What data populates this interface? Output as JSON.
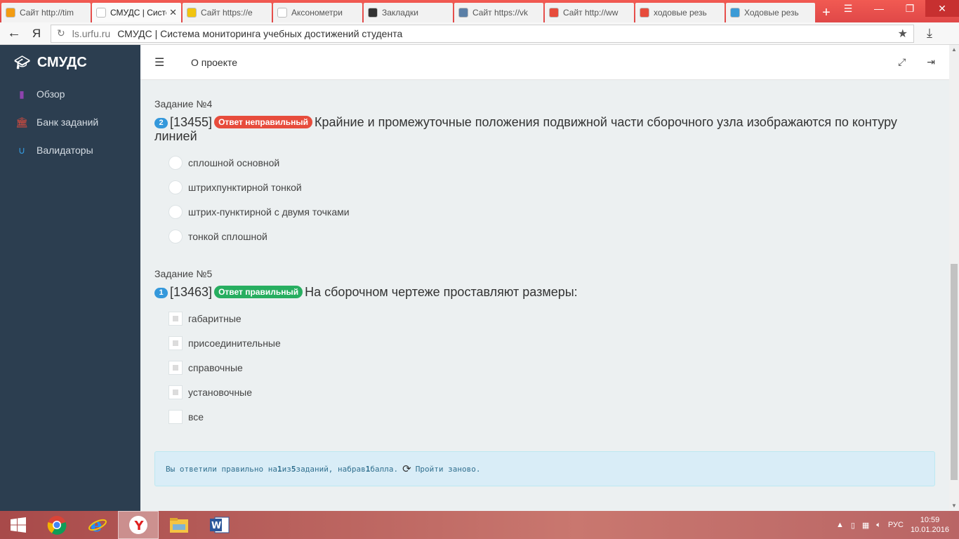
{
  "browser": {
    "tabs": [
      {
        "title": "Сайт http://tim",
        "icon_color": "#f39c12",
        "active": false
      },
      {
        "title": "СМУДС | Систе",
        "icon_color": "#ffffff",
        "active": true
      },
      {
        "title": "Сайт https://e",
        "icon_color": "#f1c40f",
        "active": false
      },
      {
        "title": "Аксонометри",
        "icon_color": "#ffffff",
        "active": false
      },
      {
        "title": "Закладки",
        "icon_color": "#333333",
        "active": false
      },
      {
        "title": "Сайт https://vk",
        "icon_color": "#5b7fa6",
        "active": false
      },
      {
        "title": "Сайт http://ww",
        "icon_color": "#e74c3c",
        "active": false
      },
      {
        "title": "ходовые резь",
        "icon_color": "#e74c3c",
        "active": false
      },
      {
        "title": "Ходовые резь",
        "icon_color": "#3b9bd6",
        "active": false
      }
    ],
    "new_tab": "+",
    "url_domain": "ls.urfu.ru",
    "url_title": "СМУДС | Система мониторинга учебных достижений студента",
    "yandex_logo": "Я"
  },
  "sidebar": {
    "brand": "СМУДС",
    "items": [
      {
        "label": "Обзор",
        "icon": "bar-chart-icon",
        "color": "#8e44ad"
      },
      {
        "label": "Банк заданий",
        "icon": "bank-icon",
        "color": "#e74c3c"
      },
      {
        "label": "Валидаторы",
        "icon": "magnet-icon",
        "color": "#3498db"
      }
    ]
  },
  "topbar": {
    "about": "О проекте"
  },
  "tasks": [
    {
      "title": "Задание №4",
      "number": "2",
      "id": "[13455]",
      "badge": "Ответ неправильный",
      "badge_type": "wrong",
      "question": "Крайние и промежуточные положения подвижной части сборочного узла изображаются по контуру линией",
      "input_type": "radio",
      "options": [
        {
          "label": "сплошной основной",
          "checked": false
        },
        {
          "label": "штрихпунктирной тонкой",
          "checked": false
        },
        {
          "label": "штрих-пунктирной с двумя точками",
          "checked": false
        },
        {
          "label": "тонкой сплошной",
          "checked": false
        }
      ]
    },
    {
      "title": "Задание №5",
      "number": "1",
      "id": "[13463]",
      "badge": "Ответ правильный",
      "badge_type": "right",
      "question": "На сборочном чертеже проставляют размеры:",
      "input_type": "checkbox",
      "options": [
        {
          "label": "габаритные",
          "checked": true
        },
        {
          "label": "присоединительные",
          "checked": true
        },
        {
          "label": "справочные",
          "checked": true
        },
        {
          "label": "установочные",
          "checked": true
        },
        {
          "label": "все",
          "checked": false
        }
      ]
    }
  ],
  "result": {
    "prefix": "Вы ответили правильно на",
    "correct": "1",
    "middle": "из",
    "total": "5",
    "middle2": "заданий, набрав",
    "score": "1",
    "suffix": "балла.",
    "retry": "Пройти заново."
  },
  "taskbar": {
    "lang": "РУС",
    "time": "10:59",
    "date": "10.01.2016"
  },
  "colors": {
    "sidebar_bg": "#2c3e50",
    "wrong": "#e74c3c",
    "right": "#27ae60",
    "info_bg": "#d9edf7"
  }
}
